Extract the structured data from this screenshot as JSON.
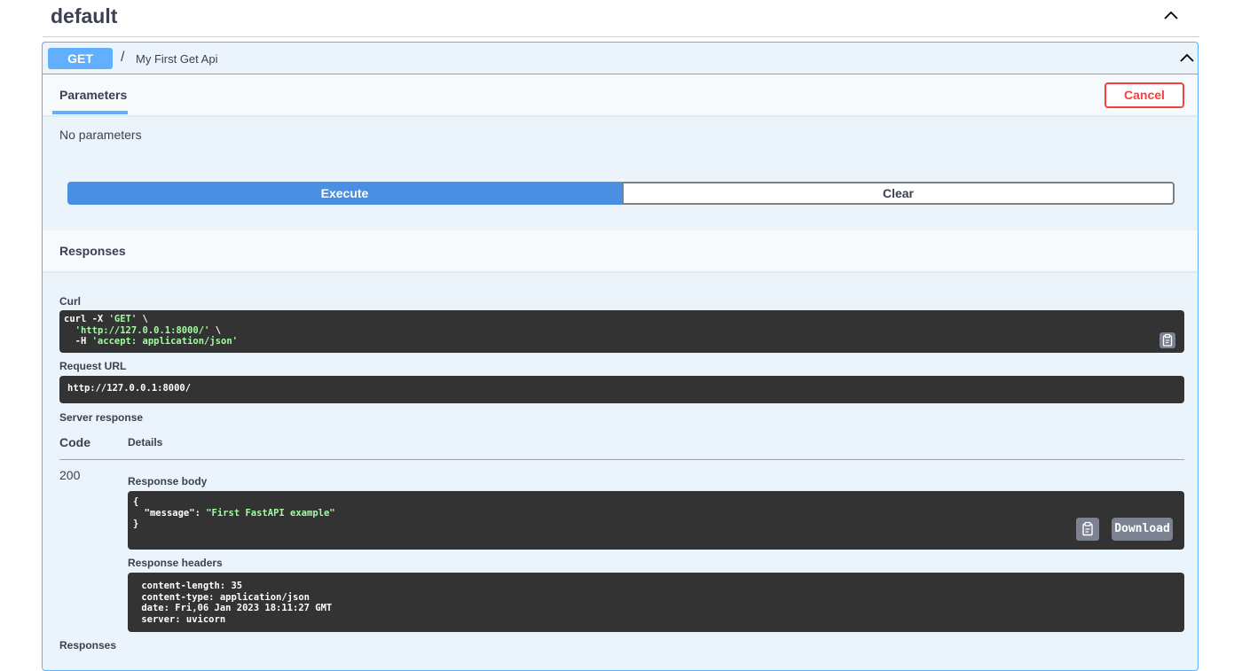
{
  "tag": {
    "title": "default"
  },
  "operation": {
    "method": "GET",
    "path": "/",
    "description": "My First Get Api"
  },
  "parameters": {
    "tab_label": "Parameters",
    "cancel_label": "Cancel",
    "empty_text": "No parameters",
    "execute_label": "Execute",
    "clear_label": "Clear"
  },
  "responses": {
    "title": "Responses",
    "curl_label": "Curl",
    "curl_lines": [
      {
        "plain": "curl -X ",
        "str": "'GET'",
        "tail": " \\"
      },
      {
        "plain": "  ",
        "str": "'http://127.0.0.1:8000/'",
        "tail": " \\"
      },
      {
        "plain": "  -H ",
        "str": "'accept: application/json'",
        "tail": ""
      }
    ],
    "request_url_label": "Request URL",
    "request_url": "http://127.0.0.1:8000/",
    "server_response_label": "Server response",
    "code_header": "Code",
    "details_header": "Details",
    "status_code": "200",
    "response_body_label": "Response body",
    "response_body_lines": [
      {
        "plain": "{",
        "key": "",
        "sep": "",
        "str": ""
      },
      {
        "plain": "  ",
        "key": "\"message\"",
        "sep": ": ",
        "str": "\"First FastAPI example\""
      },
      {
        "plain": "}",
        "key": "",
        "sep": "",
        "str": ""
      }
    ],
    "download_label": "Download",
    "response_headers_label": "Response headers",
    "response_headers_lines": [
      " content-length: 35 ",
      " content-type: application/json ",
      " date: Fri,06 Jan 2023 18:11:27 GMT ",
      " server: uvicorn "
    ],
    "bottom_label": "Responses"
  },
  "icons": {
    "collapse": "chevron-up-icon",
    "copy": "clipboard-icon"
  },
  "colors": {
    "get_accent": "#61affe",
    "execute": "#4990e2",
    "cancel": "#f93e3e",
    "code_bg": "#333333",
    "string": "#a2fca2"
  }
}
